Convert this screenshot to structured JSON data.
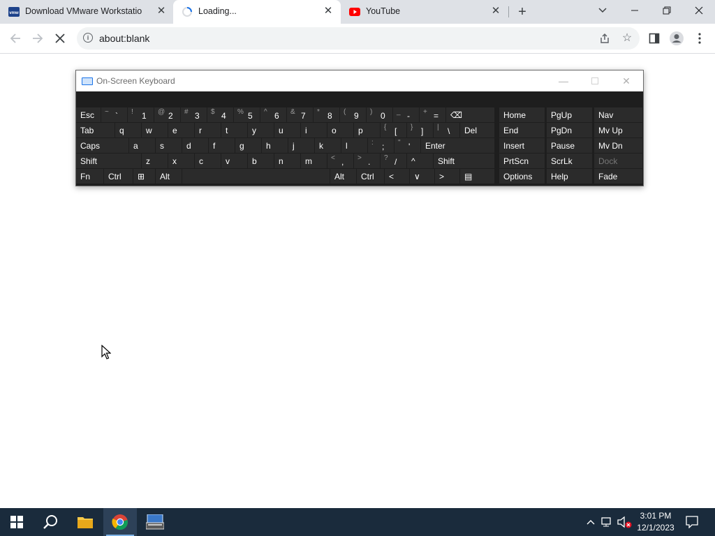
{
  "browser": {
    "tabs": [
      {
        "title": "Download VMware Workstation Pro",
        "icon": "vmware-favicon"
      },
      {
        "title": "Loading...",
        "icon": "loading-spinner",
        "active": true
      },
      {
        "title": "YouTube",
        "icon": "youtube-favicon"
      }
    ],
    "new_tab_symbol": "+",
    "address": "about:blank",
    "accent": "#1a73e8"
  },
  "osk": {
    "title": "On-Screen Keyboard",
    "rows": [
      [
        {
          "label": "Esc"
        },
        {
          "sec": "~",
          "main": "`"
        },
        {
          "sec": "!",
          "main": "1"
        },
        {
          "sec": "@",
          "main": "2"
        },
        {
          "sec": "#",
          "main": "3"
        },
        {
          "sec": "$",
          "main": "4"
        },
        {
          "sec": "%",
          "main": "5"
        },
        {
          "sec": "^",
          "main": "6"
        },
        {
          "sec": "&",
          "main": "7"
        },
        {
          "sec": "*",
          "main": "8"
        },
        {
          "sec": "(",
          "main": "9"
        },
        {
          "sec": ")",
          "main": "0"
        },
        {
          "sec": "_",
          "main": "-"
        },
        {
          "sec": "+",
          "main": "="
        },
        {
          "label": "⌫",
          "icon": "backspace-icon"
        },
        {
          "label": "Home"
        },
        {
          "label": "PgUp"
        },
        {
          "label": "Nav"
        }
      ],
      [
        {
          "label": "Tab"
        },
        {
          "label": "q"
        },
        {
          "label": "w"
        },
        {
          "label": "e"
        },
        {
          "label": "r"
        },
        {
          "label": "t"
        },
        {
          "label": "y"
        },
        {
          "label": "u"
        },
        {
          "label": "i"
        },
        {
          "label": "o"
        },
        {
          "label": "p"
        },
        {
          "sec": "{",
          "main": "["
        },
        {
          "sec": "}",
          "main": "]"
        },
        {
          "sec": "|",
          "main": "\\"
        },
        {
          "label": "Del"
        },
        {
          "label": "End"
        },
        {
          "label": "PgDn"
        },
        {
          "label": "Mv Up"
        }
      ],
      [
        {
          "label": "Caps"
        },
        {
          "label": "a"
        },
        {
          "label": "s"
        },
        {
          "label": "d"
        },
        {
          "label": "f"
        },
        {
          "label": "g"
        },
        {
          "label": "h"
        },
        {
          "label": "j"
        },
        {
          "label": "k"
        },
        {
          "label": "l"
        },
        {
          "sec": ":",
          "main": ";"
        },
        {
          "sec": "\"",
          "main": "'"
        },
        {
          "label": "Enter"
        },
        {
          "label": "Insert"
        },
        {
          "label": "Pause"
        },
        {
          "label": "Mv Dn"
        }
      ],
      [
        {
          "label": "Shift"
        },
        {
          "label": "z"
        },
        {
          "label": "x"
        },
        {
          "label": "c"
        },
        {
          "label": "v"
        },
        {
          "label": "b"
        },
        {
          "label": "n"
        },
        {
          "label": "m"
        },
        {
          "sec": "<",
          "main": ","
        },
        {
          "sec": ">",
          "main": "."
        },
        {
          "sec": "?",
          "main": "/"
        },
        {
          "label": "^",
          "icon": "arrow-up-icon"
        },
        {
          "label": "Shift"
        },
        {
          "label": "PrtScn"
        },
        {
          "label": "ScrLk"
        },
        {
          "label": "Dock",
          "dim": true
        }
      ],
      [
        {
          "label": "Fn"
        },
        {
          "label": "Ctrl"
        },
        {
          "label": "⊞",
          "icon": "windows-key-icon"
        },
        {
          "label": "Alt"
        },
        {
          "label": ""
        },
        {
          "label": "Alt"
        },
        {
          "label": "Ctrl"
        },
        {
          "label": "<",
          "icon": "arrow-left-icon"
        },
        {
          "label": "∨",
          "icon": "arrow-down-icon"
        },
        {
          "label": ">",
          "icon": "arrow-right-icon"
        },
        {
          "label": "▤",
          "icon": "context-menu-icon"
        },
        {
          "label": "Options"
        },
        {
          "label": "Help"
        },
        {
          "label": "Fade"
        }
      ]
    ]
  },
  "taskbar": {
    "time": "3:01 PM",
    "date": "12/1/2023",
    "color": "#1a2b3c"
  }
}
